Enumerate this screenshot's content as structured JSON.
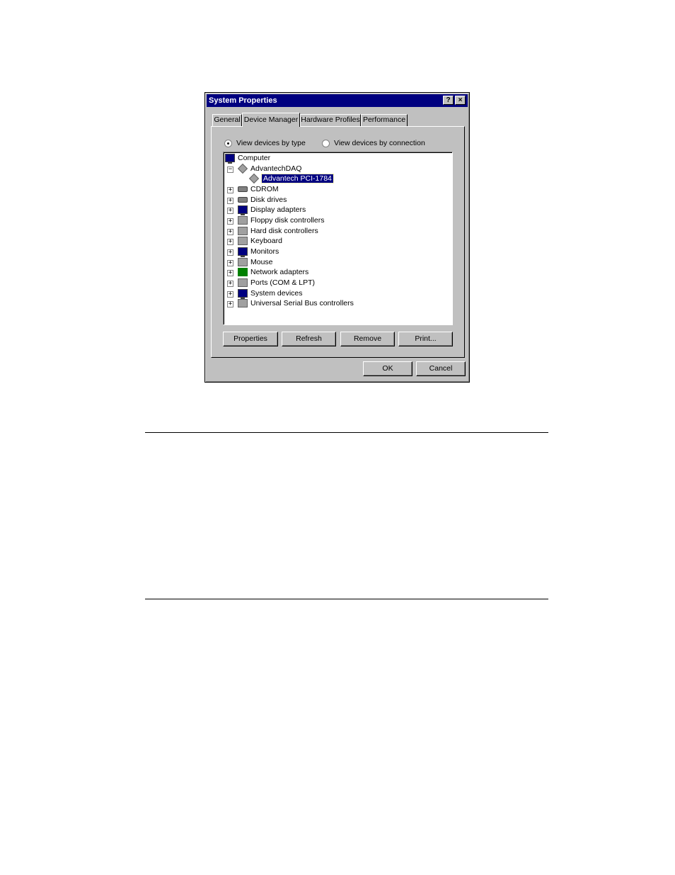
{
  "window": {
    "title": "System Properties",
    "help_glyph": "?",
    "close_glyph": "×"
  },
  "tabs": [
    {
      "label": "General",
      "active": false
    },
    {
      "label": "Device Manager",
      "active": true
    },
    {
      "label": "Hardware Profiles",
      "active": false
    },
    {
      "label": "Performance",
      "active": false
    }
  ],
  "view_options": [
    {
      "label": "View devices by type",
      "checked": true
    },
    {
      "label": "View devices by connection",
      "checked": false
    }
  ],
  "tree": {
    "root": "Computer",
    "expanded_group": "AdvantechDAQ",
    "selected_device": "Advantech PCI-1784",
    "expanded_glyph": "−",
    "collapsed_glyph": "+",
    "categories": [
      {
        "label": "CDROM",
        "icon": "cdrom-icon"
      },
      {
        "label": "Disk drives",
        "icon": "disk-drive-icon"
      },
      {
        "label": "Display adapters",
        "icon": "display-adapter-icon"
      },
      {
        "label": "Floppy disk controllers",
        "icon": "floppy-controller-icon"
      },
      {
        "label": "Hard disk controllers",
        "icon": "hard-disk-controller-icon"
      },
      {
        "label": "Keyboard",
        "icon": "keyboard-icon"
      },
      {
        "label": "Monitors",
        "icon": "monitor-icon"
      },
      {
        "label": "Mouse",
        "icon": "mouse-icon"
      },
      {
        "label": "Network adapters",
        "icon": "network-adapter-icon"
      },
      {
        "label": "Ports (COM & LPT)",
        "icon": "port-icon"
      },
      {
        "label": "System devices",
        "icon": "system-device-icon"
      },
      {
        "label": "Universal Serial Bus controllers",
        "icon": "usb-icon"
      }
    ]
  },
  "buttons": {
    "properties": "Properties",
    "refresh": "Refresh",
    "remove": "Remove",
    "print": "Print...",
    "ok": "OK",
    "cancel": "Cancel"
  }
}
